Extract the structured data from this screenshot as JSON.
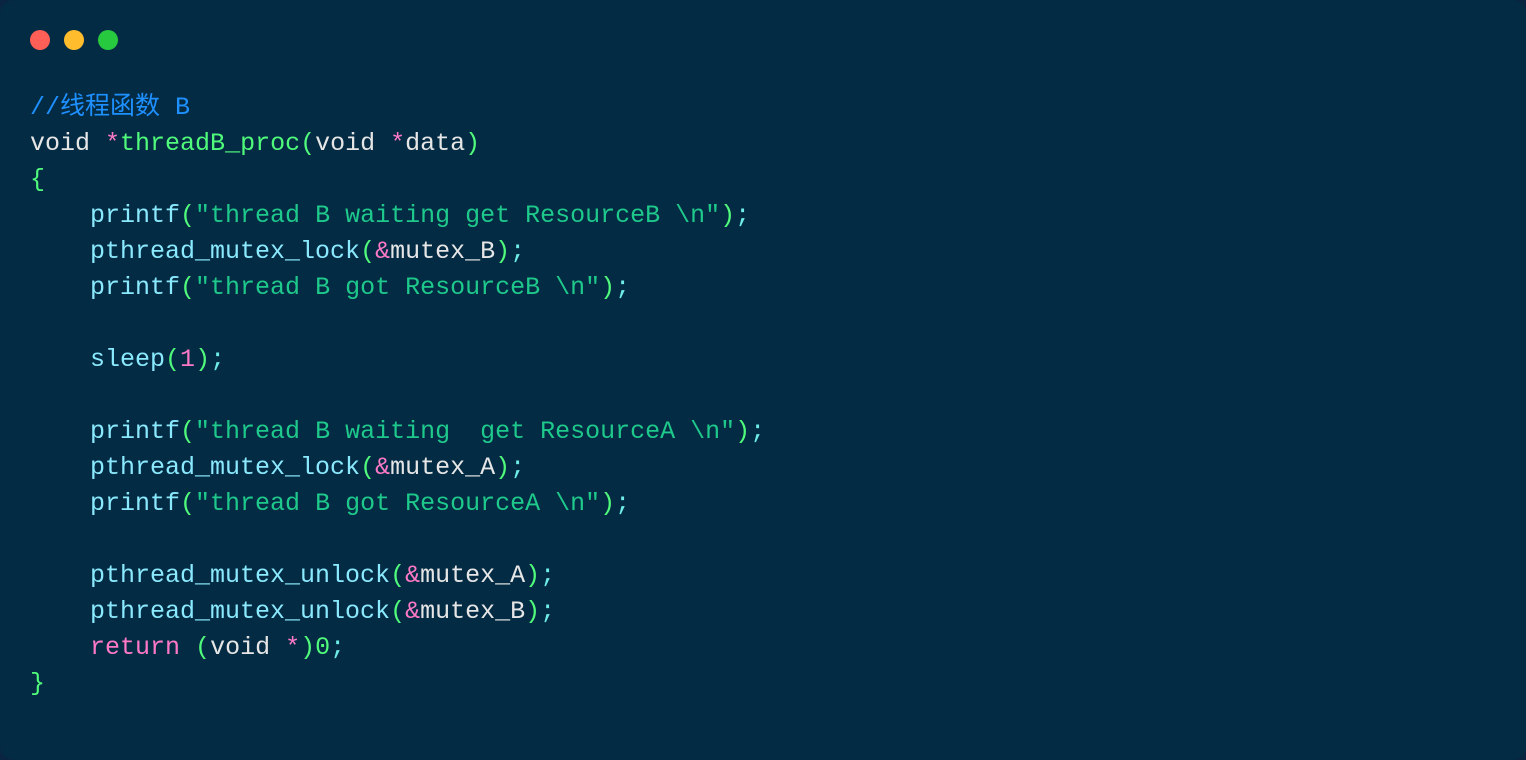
{
  "code": {
    "comment": "//线程函数 B",
    "kw_void1": "void",
    "op_star1": "*",
    "fn_name": "threadB_proc",
    "lparen1": "(",
    "kw_void2": "void",
    "op_star2": "*",
    "param_data": "data",
    "rparen1": ")",
    "lbrace": "{",
    "indent": "    ",
    "fn_printf": "printf",
    "lp": "(",
    "rp": ")",
    "semi": ";",
    "str1": "\"thread B waiting get ResourceB \\n\"",
    "fn_lock": "pthread_mutex_lock",
    "amp": "&",
    "mutexB": "mutex_B",
    "str2": "\"thread B got ResourceB \\n\"",
    "fn_sleep": "sleep",
    "num1": "1",
    "str3": "\"thread B waiting  get ResourceA \\n\"",
    "mutexA": "mutex_A",
    "str4": "\"thread B got ResourceA \\n\"",
    "fn_unlock": "pthread_mutex_unlock",
    "kw_return": "return",
    "kw_void3": "void",
    "op_star3": "*",
    "num0": "0",
    "rbrace": "}"
  }
}
